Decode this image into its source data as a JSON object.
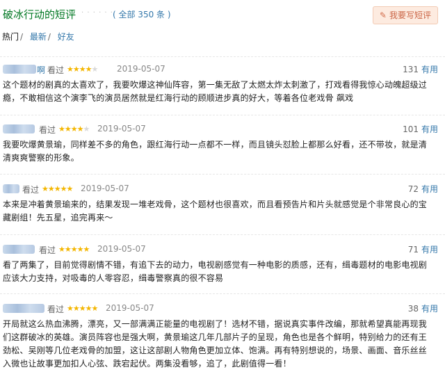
{
  "header": {
    "title": "破冰行动的短评",
    "dots": "· · · · · ·",
    "total": "( 全部 350 条 )",
    "write_label": "我要写短评"
  },
  "tabs": [
    {
      "label": "热门"
    },
    {
      "label": "最新"
    },
    {
      "label": "好友"
    }
  ],
  "tab_separator": "/",
  "watched_label": "看过",
  "useful_label": "有用",
  "comments": [
    {
      "user_fragment": "啊",
      "stars": 4,
      "date": "2019-05-07",
      "votes": "131",
      "text": "这个题材的剧真的太喜欢了，我要吹爆这神仙阵容，第一集无敌了太燃太炸太刺激了，打戏看得我惊心动魄超级过瘾，不敢相信这个演李飞的演员居然就是红海行动的顾顺进步真的好大，等着各位老戏骨 飙戏"
    },
    {
      "user_fragment": "",
      "stars": 4,
      "date": "2019-05-07",
      "votes": "101",
      "text": "我要吹爆黄景瑜，同样差不多的角色，跟红海行动一点都不一样，而且镜头怼脸上都那么好看，还不带妆，就是清清爽爽警察的形象。"
    },
    {
      "user_fragment": "",
      "stars": 5,
      "date": "2019-05-07",
      "votes": "72",
      "text": "本来是冲着黄景瑜来的，结果发现一堆老戏骨，这个题材也很喜欢，而且看预告片和片头就感觉是个非常良心的宝藏剧组！先五星，追完再来～"
    },
    {
      "user_fragment": "",
      "stars": 5,
      "date": "2019-05-07",
      "votes": "71",
      "text": "看了两集了，目前觉得剧情不错，有追下去的动力，电视剧感觉有一种电影的质感，还有，缉毒题材的电影电视剧应该大力支持，对吸毒的人零容忍，缉毒警察真的很不容易"
    },
    {
      "user_fragment": "",
      "stars": 5,
      "date": "2019-05-07",
      "votes": "38",
      "text": "开局就这么热血沸腾，漂亮，又一部满满正能量的电视剧了！选材不错，据说真实事件改编，那就希望真能再现我们这群破冰的英雄。演员阵容也是强大啊，黄景瑜这几年几部片子的呈现，角色也是各个鲜明，特别给力的还有王劲松、吴刚等几位老戏骨的加盟，这让这部剧人物角色更加立体、饱满。再有特别想说的，场景、画面、音乐丝丝入微也让故事更加扣人心弦、跌宕起伏。两集没看够，追了，此剧值得一看！"
    }
  ],
  "colors": {
    "title": "#007722",
    "link": "#3377aa",
    "star": "#f4b600",
    "button_bg": "#fdebe0",
    "button_text": "#ca6445"
  },
  "icons": {
    "write": "pencil-icon",
    "star": "star-icon"
  }
}
